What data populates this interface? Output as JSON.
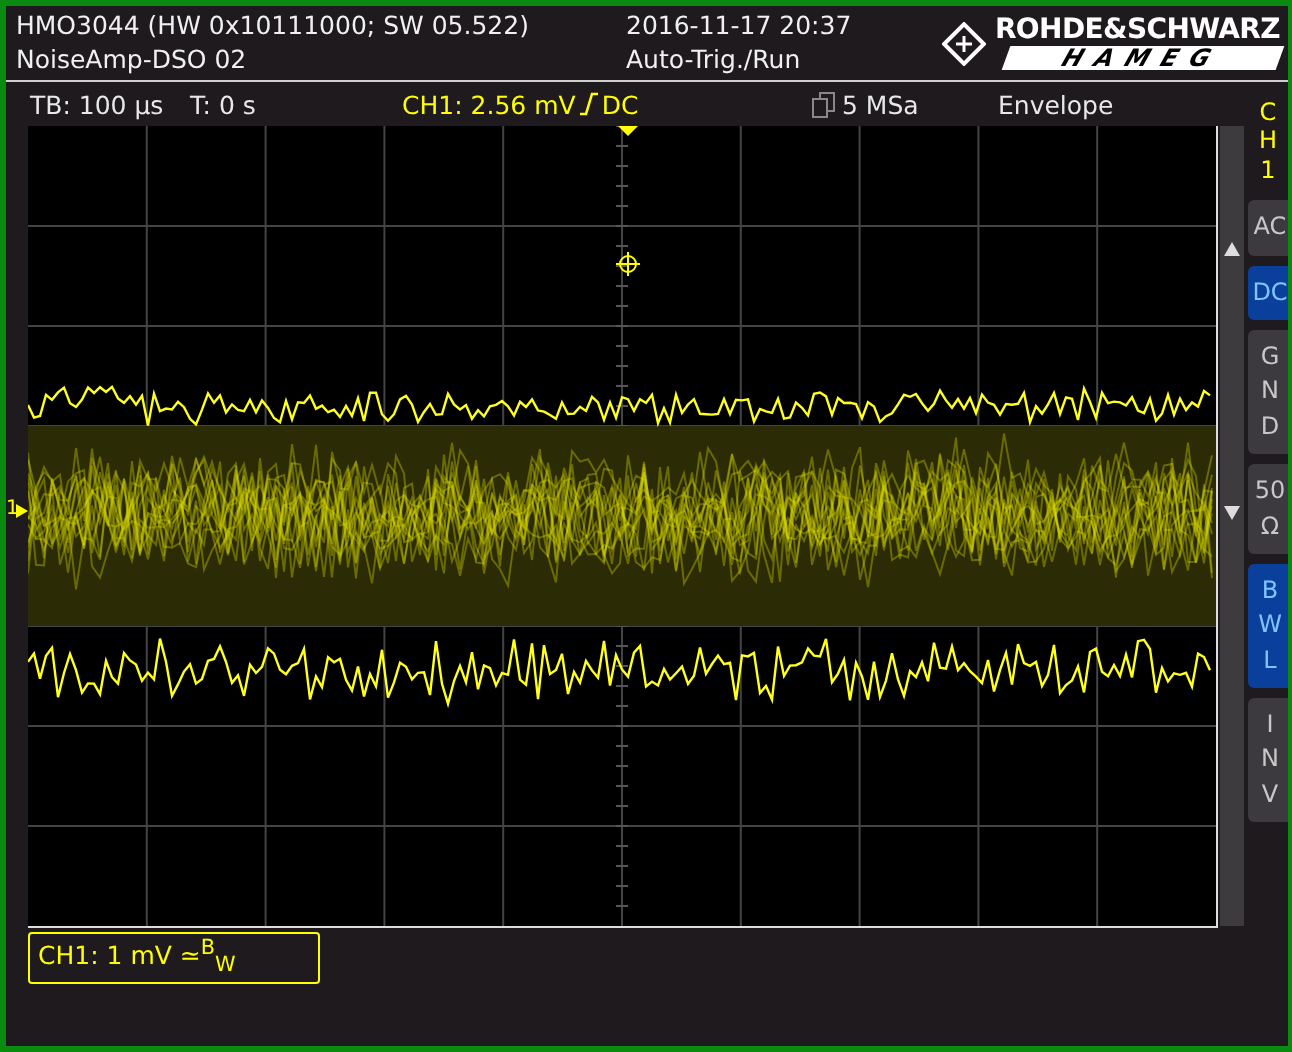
{
  "header": {
    "instrument": "HMO3044 (HW 0x10111000; SW 05.522)",
    "setup": "NoiseAmp-DSO 02",
    "datetime": "2016-11-17 20:37",
    "trigger_state": "Auto-Trig./Run",
    "brand": "ROHDE&SCHWARZ",
    "brand_sub": "HAMEG"
  },
  "status_bar": {
    "timebase": "TB: 100 µs",
    "trigger_time": "T: 0 s",
    "trigger_level": "CH1: 2.56 mV",
    "trigger_coupling": "DC",
    "sample_rate": "5 MSa",
    "mode": "Envelope"
  },
  "channel_marker": "1",
  "channel_label": "CH1: 1 mV ≃$^{B}$$_{W}$",
  "sidebar": {
    "title": "CH1",
    "buttons": [
      {
        "label": "AC",
        "kind": "inline",
        "selected": false
      },
      {
        "label": "DC",
        "kind": "inline",
        "selected": true
      },
      {
        "label": "GND",
        "kind": "stacked",
        "selected": false
      },
      {
        "label": "50 Ω",
        "kind": "wrapped",
        "selected": false
      },
      {
        "label": "BWL",
        "kind": "stacked",
        "selected": true
      },
      {
        "label": "INV",
        "kind": "stacked",
        "selected": false
      }
    ]
  }
}
